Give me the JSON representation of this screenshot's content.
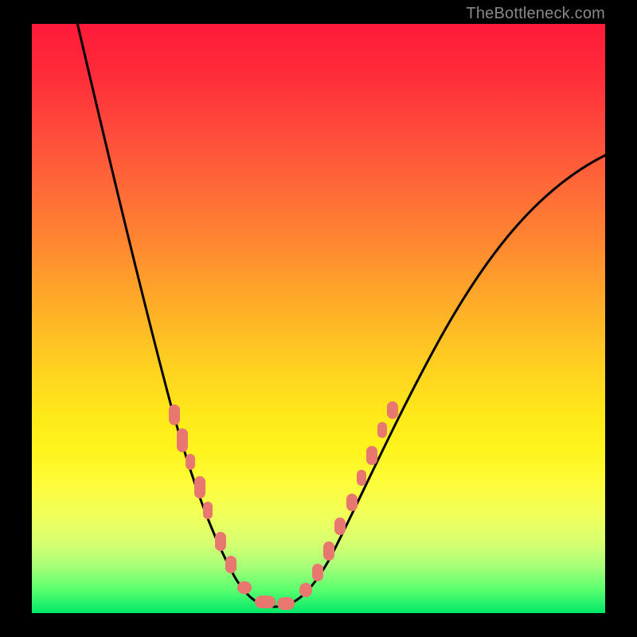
{
  "watermark": "TheBottleneck.com",
  "colors": {
    "gradient_top": "#ff1a3a",
    "gradient_mid": "#ffd020",
    "gradient_bottom": "#00e868",
    "curve": "#000000",
    "markers": "#e8776f",
    "frame": "#000000",
    "watermark": "#888888"
  },
  "chart_data": {
    "type": "line",
    "title": "",
    "xlabel": "",
    "ylabel": "",
    "xlim": [
      0,
      100
    ],
    "ylim": [
      0,
      100
    ],
    "legend": false,
    "grid": false,
    "annotations": [
      "TheBottleneck.com"
    ],
    "background": "vertical red→yellow→green heat gradient (green = optimal)",
    "series": [
      {
        "name": "bottleneck-curve",
        "style": "solid-black",
        "x": [
          8,
          12,
          16,
          20,
          24,
          28,
          32,
          36,
          38,
          41,
          44,
          47,
          51,
          56,
          62,
          69,
          78,
          90,
          100
        ],
        "values": [
          102,
          85,
          68,
          53,
          40,
          28,
          18,
          10,
          5,
          2,
          1,
          3,
          8,
          16,
          28,
          42,
          56,
          70,
          78
        ]
      },
      {
        "name": "sample-markers",
        "style": "salmon-dots",
        "x": [
          24,
          26,
          27,
          29,
          30,
          32,
          34,
          36,
          39,
          43,
          47,
          49,
          51,
          53,
          55,
          57,
          59,
          61,
          63
        ],
        "values": [
          35,
          31,
          27,
          23,
          19,
          14,
          10,
          5,
          2,
          1,
          5,
          8,
          12,
          16,
          20,
          24,
          28,
          32,
          36
        ]
      }
    ],
    "note": "Values are in percent of plot height from the bottom (0 = bottom/green). X is percent of plot width. Curve and markers estimated from pixels; no numeric axis labels present in source image."
  }
}
